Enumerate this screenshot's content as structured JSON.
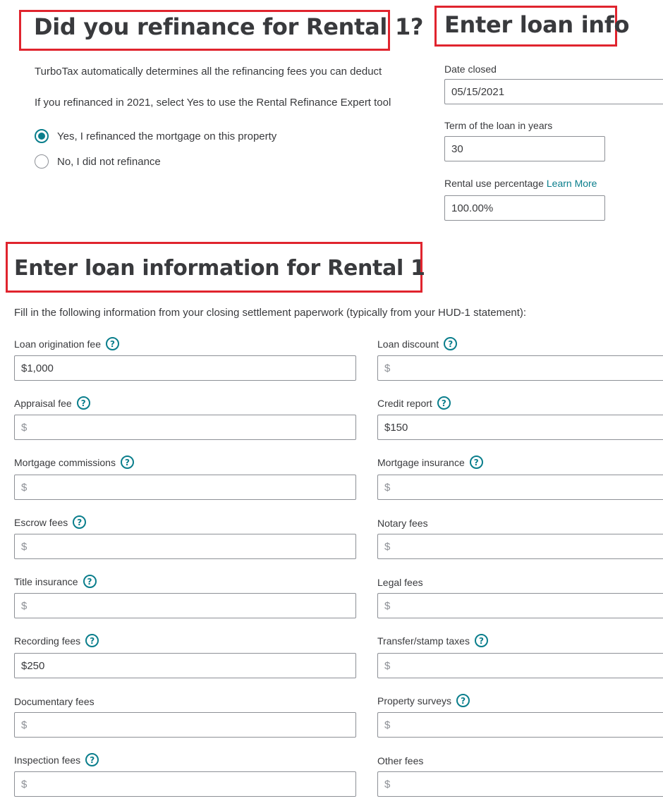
{
  "refinance": {
    "title": "Did you refinance for Rental 1?",
    "line1": "TurboTax automatically determines all the refinancing fees you can deduct",
    "line2": "If you refinanced in 2021, select Yes to use the Rental Refinance Expert tool",
    "option_yes": "Yes, I refinanced the mortgage on this property",
    "option_no": "No, I did not refinance",
    "selected": "yes"
  },
  "loan_info": {
    "title": "Enter loan info",
    "date_closed_label": "Date closed",
    "date_closed_value": "05/15/2021",
    "term_label": "Term of the loan in years",
    "term_value": "30",
    "rental_use_label": "Rental use percentage",
    "learn_more": "Learn More",
    "rental_use_value": "100.00%"
  },
  "loan_information": {
    "title": "Enter loan information for Rental 1",
    "intro": "Fill in the following information from your closing settlement paperwork (typically from your HUD-1 statement):",
    "placeholder": "$",
    "help_glyph": "?",
    "fees": {
      "loan_origination": {
        "label": "Loan origination fee",
        "value": "$1,000"
      },
      "loan_discount": {
        "label": "Loan discount",
        "value": ""
      },
      "appraisal": {
        "label": "Appraisal fee",
        "value": ""
      },
      "credit_report": {
        "label": "Credit report",
        "value": "$150"
      },
      "mortgage_commissions": {
        "label": "Mortgage commissions",
        "value": ""
      },
      "mortgage_insurance": {
        "label": "Mortgage insurance",
        "value": ""
      },
      "escrow": {
        "label": "Escrow fees",
        "value": ""
      },
      "notary": {
        "label": "Notary fees",
        "value": ""
      },
      "title_insurance": {
        "label": "Title insurance",
        "value": ""
      },
      "legal": {
        "label": "Legal fees",
        "value": ""
      },
      "recording": {
        "label": "Recording fees",
        "value": "$250"
      },
      "transfer_stamp": {
        "label": "Transfer/stamp taxes",
        "value": ""
      },
      "documentary": {
        "label": "Documentary fees",
        "value": ""
      },
      "property_surveys": {
        "label": "Property surveys",
        "value": ""
      },
      "inspection": {
        "label": "Inspection fees",
        "value": ""
      },
      "other": {
        "label": "Other fees",
        "value": ""
      }
    }
  },
  "colors": {
    "accent": "#0a7e8c",
    "highlight_box": "#e0242e",
    "text": "#393a3d",
    "border": "#8d9096"
  }
}
